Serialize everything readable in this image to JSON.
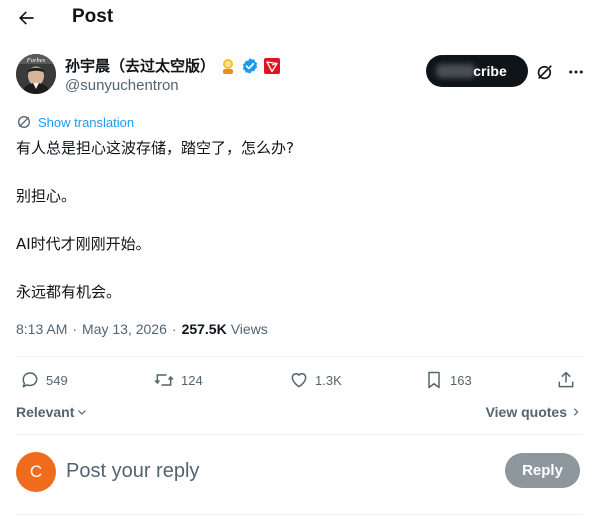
{
  "header": {
    "title": "Post",
    "back_icon": "arrow-left-icon"
  },
  "author": {
    "display_name": "孙宇晨（去过太空版）",
    "handle": "@sunyuchentron",
    "avatar_icon": "profile-photo",
    "badges": [
      "astronaut-emoji-icon",
      "verified-check-icon",
      "tron-logo-icon"
    ],
    "verified_color": "#1d9bf0"
  },
  "subscribe": {
    "label": "cribe"
  },
  "post": {
    "translate_label": "Show translation",
    "paragraphs": [
      "有人总是担心这波存储，踏空了，怎么办?",
      "别担心。",
      "AI时代才刚刚开始。",
      "永远都有机会。"
    ],
    "time": "8:13 AM",
    "dot": "·",
    "date": "May 13, 2026",
    "views_count": "257.5K",
    "views_label": "Views"
  },
  "actions": {
    "replies": "549",
    "reposts": "124",
    "likes": "1.3K",
    "bookmarks": "163"
  },
  "sort": {
    "label": "Relevant",
    "view_quotes": "View quotes"
  },
  "composer": {
    "avatar_letter": "C",
    "placeholder": "Post your reply",
    "reply_label": "Reply",
    "avatar_color": "#ef6c1c"
  },
  "colors": {
    "accent": "#1d9bf0",
    "text": "#0f1419",
    "muted": "#536471",
    "divider": "#eff3f4"
  }
}
